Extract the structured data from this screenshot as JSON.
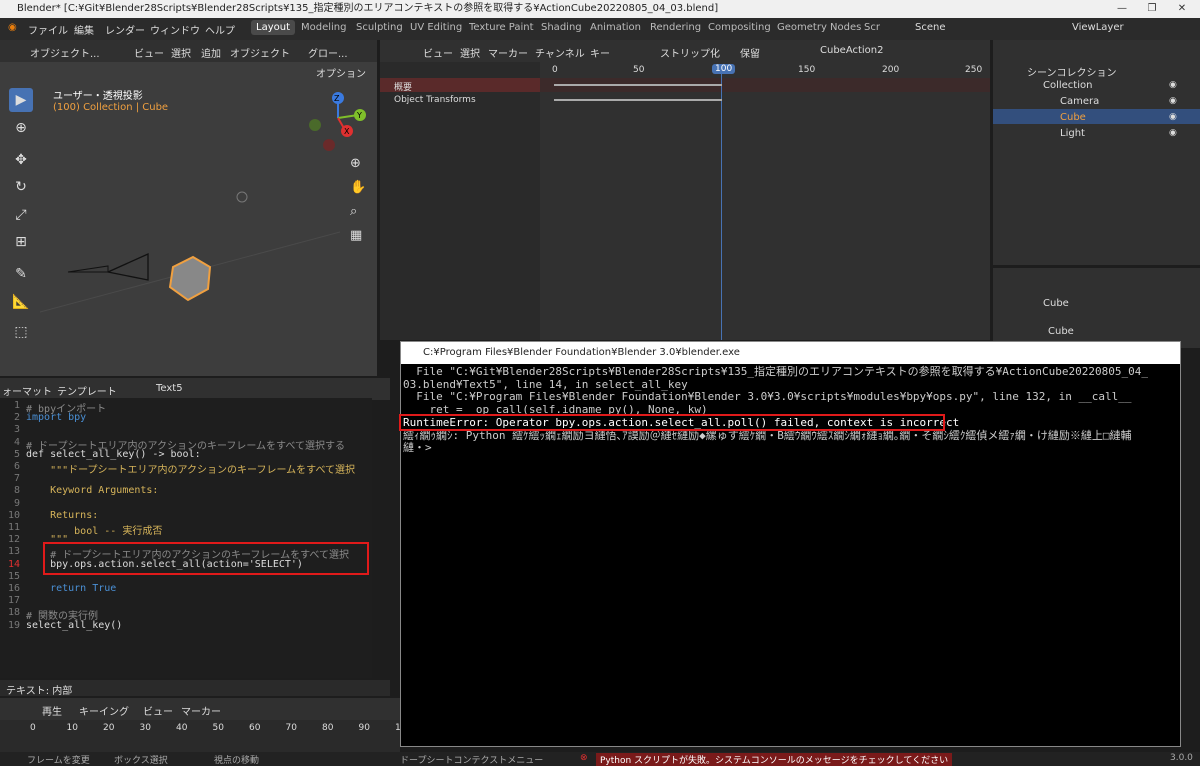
{
  "window": {
    "title": "Blender* [C:¥Git¥Blender28Scripts¥Blender28Scripts¥135_指定種別のエリアコンテキストの参照を取得する¥ActionCube20220805_04_03.blend]",
    "min": "—",
    "max": "❐",
    "close": "✕"
  },
  "menu": {
    "file": "ファイル",
    "edit": "編集",
    "render": "レンダー",
    "window": "ウィンドウ",
    "help": "ヘルプ"
  },
  "tabs": [
    "Layout",
    "Modeling",
    "Sculpting",
    "UV Editing",
    "Texture Paint",
    "Shading",
    "Animation",
    "Rendering",
    "Compositing",
    "Geometry Nodes",
    "Scr"
  ],
  "scene": {
    "name": "Scene",
    "view_layer": "ViewLayer"
  },
  "viewport": {
    "mode": "オブジェクト...",
    "view": "ビュー",
    "select": "選択",
    "add": "追加",
    "object": "オブジェクト",
    "orient": "グロー...",
    "options": "オプション",
    "title": "ユーザー・透視投影",
    "collection": "(100) Collection | Cube",
    "gizmo": {
      "x": "X",
      "y": "Y",
      "z": "Z"
    }
  },
  "dopesheet": {
    "view": "ビュー",
    "select": "選択",
    "marker": "マーカー",
    "channel": "チャンネル",
    "key": "キー",
    "strip": "ストリップ化",
    "keep": "保留",
    "action": "CubeAction2",
    "summary": "概要",
    "transforms": "Object Transforms",
    "frames": [
      "0",
      "50",
      "100",
      "150",
      "200",
      "250"
    ],
    "current_frame": "100"
  },
  "outliner": {
    "scene_collection": "シーンコレクション",
    "collection": "Collection",
    "items": [
      "Camera",
      "Cube",
      "Light"
    ]
  },
  "properties": {
    "object": "Cube",
    "mesh": "Cube"
  },
  "texteditor": {
    "format": "ォーマット",
    "template": "テンプレート",
    "name": "Text5",
    "status": "テキスト: 内部",
    "lines": [
      {
        "n": "1",
        "t": "# bpyインポート",
        "c": "cm"
      },
      {
        "n": "2",
        "t": "import bpy",
        "c": "kw"
      },
      {
        "n": "3",
        "t": "",
        "c": ""
      },
      {
        "n": "4",
        "t": "# ドープシートエリア内のアクションのキーフレームをすべて選択する",
        "c": "cm"
      },
      {
        "n": "5",
        "t": "def select_all_key() -> bool:",
        "c": ""
      },
      {
        "n": "6",
        "t": "    \"\"\"ドープシートエリア内のアクションのキーフレームをすべて選択",
        "c": "st"
      },
      {
        "n": "7",
        "t": "",
        "c": ""
      },
      {
        "n": "8",
        "t": "    Keyword Arguments:",
        "c": "st"
      },
      {
        "n": "9",
        "t": "",
        "c": ""
      },
      {
        "n": "10",
        "t": "    Returns:",
        "c": "st"
      },
      {
        "n": "11",
        "t": "        bool -- 実行成否",
        "c": "st"
      },
      {
        "n": "12",
        "t": "    \"\"\"",
        "c": "st"
      },
      {
        "n": "13",
        "t": "    # ドープシートエリア内のアクションのキーフレームをすべて選択",
        "c": "cm"
      },
      {
        "n": "14",
        "t": "    bpy.ops.action.select_all(action='SELECT')",
        "c": ""
      },
      {
        "n": "15",
        "t": "",
        "c": ""
      },
      {
        "n": "16",
        "t": "    return True",
        "c": "kw"
      },
      {
        "n": "17",
        "t": "",
        "c": ""
      },
      {
        "n": "18",
        "t": "# 関数の実行例",
        "c": "cm"
      },
      {
        "n": "19",
        "t": "select_all_key()",
        "c": ""
      }
    ]
  },
  "timeline": {
    "play": "再生",
    "keying": "キーイング",
    "view": "ビュー",
    "marker": "マーカー",
    "frames": [
      "0",
      "10",
      "20",
      "30",
      "40",
      "50",
      "60",
      "70",
      "80",
      "90",
      "10"
    ]
  },
  "console": {
    "title": "C:¥Program Files¥Blender Foundation¥Blender 3.0¥blender.exe",
    "lines": [
      "  File \"C:¥Git¥Blender28Scripts¥Blender28Scripts¥135_指定種別のエリアコンテキストの参照を取得する¥ActionCube20220805_04_",
      "03.blend¥Text5\", line 14, in select_all_key",
      "  File \"C:¥Program Files¥Blender Foundation¥Blender 3.0¥3.0¥scripts¥modules¥bpy¥ops.py\", line 132, in __call__",
      "    ret = _op_call(self.idname_py(), None, kw)",
      "RuntimeError: Operator bpy.ops.action.select_all.poll() failed, context is incorrect",
      "繧ｨ繝ｩ繝ｼ: Python 繧ｹ繧ｯ繝ｪ繝励ヨ縺悟､ｱ謨励＠縺ｾ縺励◆縲ゅす繧ｹ繝・Β繧ｳ繝ｳ繧ｽ繝ｼ繝ｫ縺ｮ繝｡繝・そ繝ｼ繧ｸ繧偵メ繧ｧ繝・け縺励※縺上□縺輔",
      "縺・>"
    ]
  },
  "statusbar": {
    "change_frame": "フレームを変更",
    "box_select": "ボックス選択",
    "move_view": "視点の移動",
    "context_menu": "ドープシートコンテクストメニュー",
    "error": "Python スクリプトが失敗。システムコンソールのメッセージをチェックしてください",
    "version": "3.0.0"
  },
  "colors": {
    "accent": "#4772b3",
    "error_red": "#e01a1a",
    "selected_orange": "#f0a040"
  }
}
